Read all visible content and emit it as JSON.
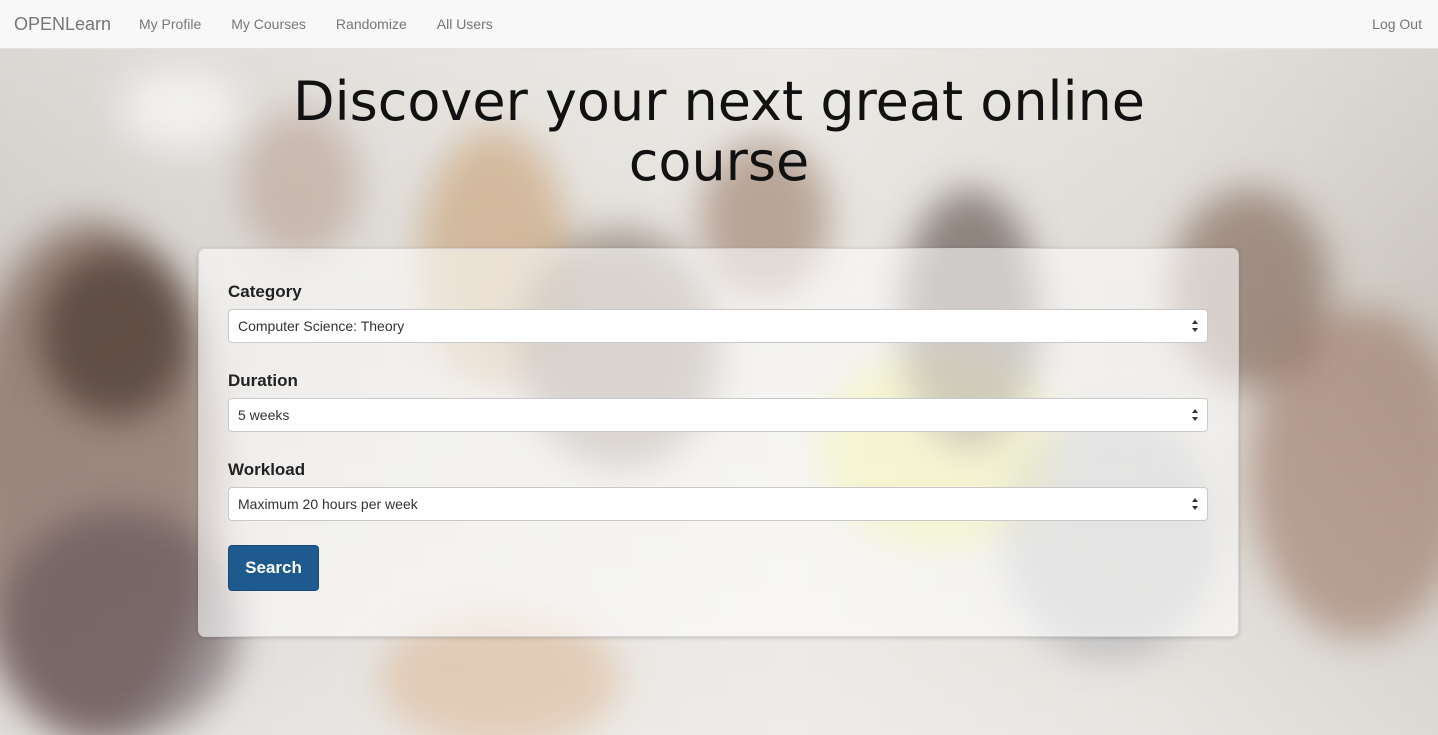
{
  "navbar": {
    "brand": "OPENLearn",
    "links": [
      "My Profile",
      "My Courses",
      "Randomize",
      "All Users"
    ],
    "logout": "Log Out"
  },
  "hero": {
    "title_line1": "Discover your next great online",
    "title_line2": "course"
  },
  "form": {
    "category": {
      "label": "Category",
      "value": "Computer Science: Theory"
    },
    "duration": {
      "label": "Duration",
      "value": "5 weeks"
    },
    "workload": {
      "label": "Workload",
      "value": "Maximum 20 hours per week"
    },
    "search_label": "Search"
  },
  "colors": {
    "primary_button": "#1f5a8e",
    "navbar_bg": "#f8f8f8",
    "nav_text": "#777777"
  }
}
